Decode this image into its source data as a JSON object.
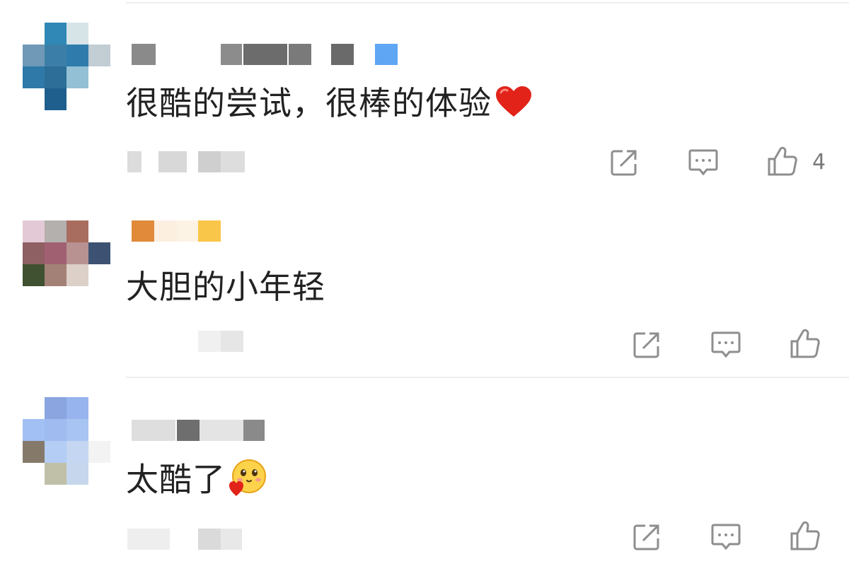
{
  "comments": [
    {
      "text": "很酷的尝试，很棒的体验",
      "emoji": "heart-emoji",
      "like_count": "4",
      "avatar_colors": [
        "#ffffff",
        "#2f88b5",
        "#d6e4e8",
        "#ffffff",
        "#6f99b6",
        "#3b7fa8",
        "#2f7bac",
        "#c2cdd4",
        "#2e79a8",
        "#2d6e99",
        "#93c0d5",
        "#ffffff",
        "#ffffff",
        "#1f5f8e",
        "#ffffff",
        "#ffffff"
      ],
      "name_colors": [
        "#8a8a8a",
        "#8c8c8c",
        "#6c6c6c",
        "#7a7a7a",
        "#6a6a6a",
        "#5fa6f5"
      ],
      "meta_colors": [
        "#dcdcdc",
        "#d8d8d8",
        "#cfcfcf",
        "#dddddd"
      ]
    },
    {
      "text": "大胆的小年轻",
      "emoji": "",
      "like_count": "",
      "avatar_colors": [
        "#e3c9d6",
        "#b3b0ae",
        "#a86d5f",
        "#ffffff",
        "#8e5f63",
        "#a06072",
        "#b89291",
        "#3d5272",
        "#3f5130",
        "#a38176",
        "#ddd0c8",
        "#ffffff",
        "#ffffff",
        "#ffffff",
        "#ffffff",
        "#ffffff"
      ],
      "name_colors": [
        "#e08a3a",
        "#fcefe0",
        "#fdf3e4",
        "#f9c649"
      ],
      "meta_colors": [
        "#f0f0f0",
        "#e6e6e6"
      ]
    },
    {
      "text": "太酷了",
      "emoji": "blushing-face-emoji",
      "like_count": "",
      "avatar_colors": [
        "#ffffff",
        "#8aa5e0",
        "#97b4ee",
        "#ffffff",
        "#a3c0f4",
        "#9fbbf0",
        "#a7c4f2",
        "#ffffff",
        "#857a6a",
        "#b3cdf5",
        "#c4d6f1",
        "#f3f3f3",
        "#ffffff",
        "#c0c0a8",
        "#c6d6ec",
        "#ffffff"
      ],
      "name_colors": [
        "#dedede",
        "#6e6e6e",
        "#e4e4e4",
        "#8a8a8a"
      ],
      "meta_colors": [
        "#eeeeee",
        "#dadada",
        "#e8e8e8"
      ]
    }
  ],
  "icons": {
    "share": "share-icon",
    "reply": "reply-icon",
    "like": "thumbs-up-icon"
  },
  "colors": {
    "text": "#222222",
    "icon": "#8e8e8e",
    "divider": "#eeeeee"
  }
}
